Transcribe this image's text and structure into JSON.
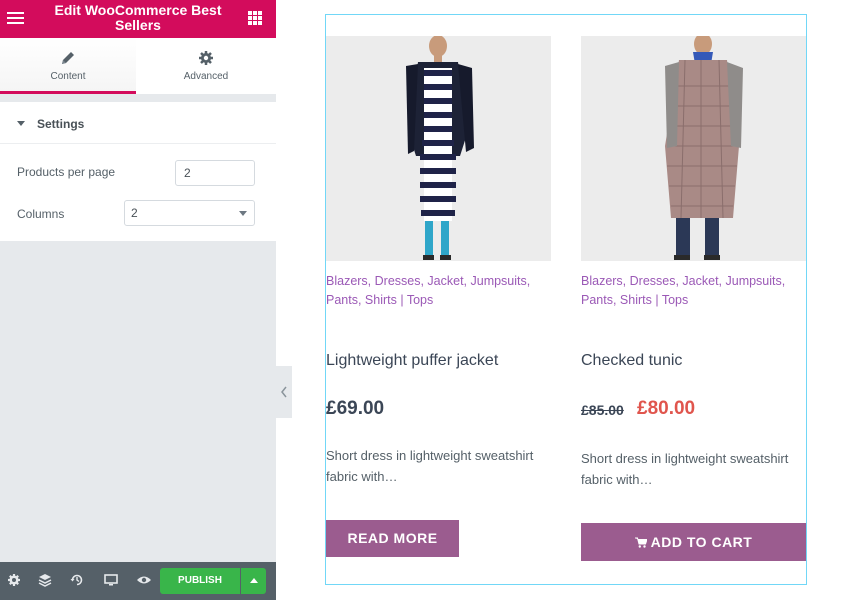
{
  "panel": {
    "title": "Edit WooCommerce Best Sellers",
    "tabs": [
      {
        "label": "Content",
        "icon": "pencil-icon"
      },
      {
        "label": "Advanced",
        "icon": "gear-icon"
      }
    ],
    "section_title": "Settings",
    "products_per_page": {
      "label": "Products per page",
      "value": "2"
    },
    "columns": {
      "label": "Columns",
      "value": "2"
    },
    "footer": {
      "publish_label": "PUBLISH"
    },
    "colors": {
      "brand": "#d30c5c",
      "publish": "#39b54a"
    }
  },
  "products": [
    {
      "categories": "Blazers, Dresses, Jacket, Jumpsuits, Pants, Shirts | Tops",
      "name": "Lightweight puffer jacket",
      "price": "£69.00",
      "description": "Short dress in lightweight sweatshirt fabric with…",
      "button": "READ MORE"
    },
    {
      "categories": "Blazers, Dresses, Jacket, Jumpsuits, Pants, Shirts | Tops",
      "name": "Checked tunic",
      "price_old": "£85.00",
      "price_new": "£80.00",
      "description": "Short dress in lightweight sweatshirt fabric with…",
      "button": "ADD TO CART"
    }
  ],
  "accent": {
    "link": "#9b59b6",
    "sale": "#e0554d",
    "button": "#9b5c8f"
  }
}
